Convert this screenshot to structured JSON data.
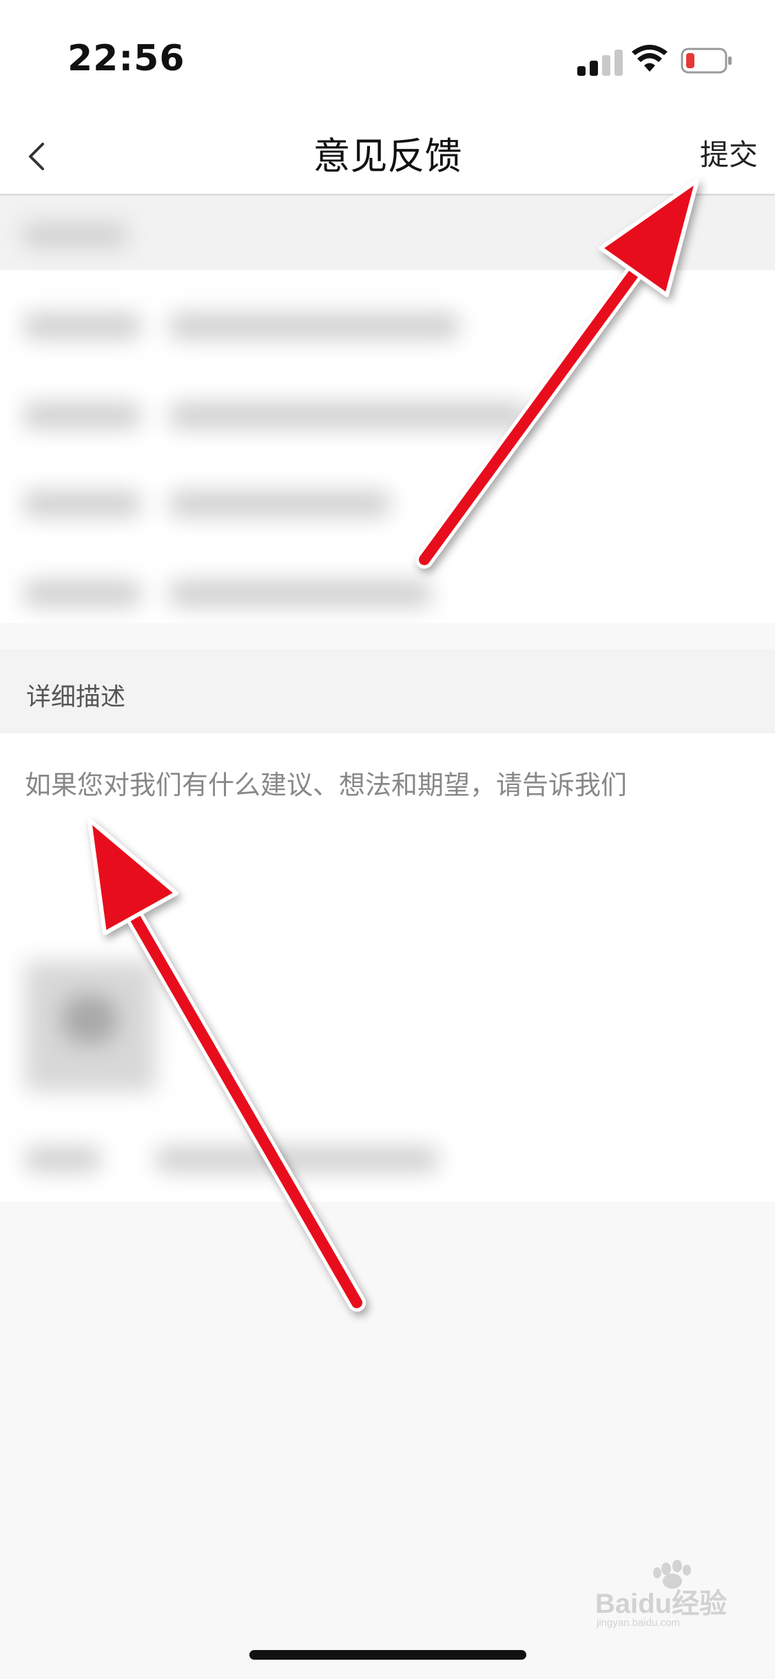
{
  "status_bar": {
    "time": "22:56"
  },
  "nav": {
    "title": "意见反馈",
    "submit_label": "提交"
  },
  "detail_section": {
    "label": "详细描述",
    "placeholder": "如果您对我们有什么建议、想法和期望，请告诉我们"
  },
  "watermark": {
    "brand": "Baidu经验",
    "sub": "jingyan.baidu.com"
  },
  "colors": {
    "annotation_arrow": "#e8101a",
    "battery_low": "#e53935"
  },
  "icons": [
    "back-chevron-icon",
    "cellular-signal-icon",
    "wifi-icon",
    "battery-icon",
    "baidu-paw-icon"
  ]
}
